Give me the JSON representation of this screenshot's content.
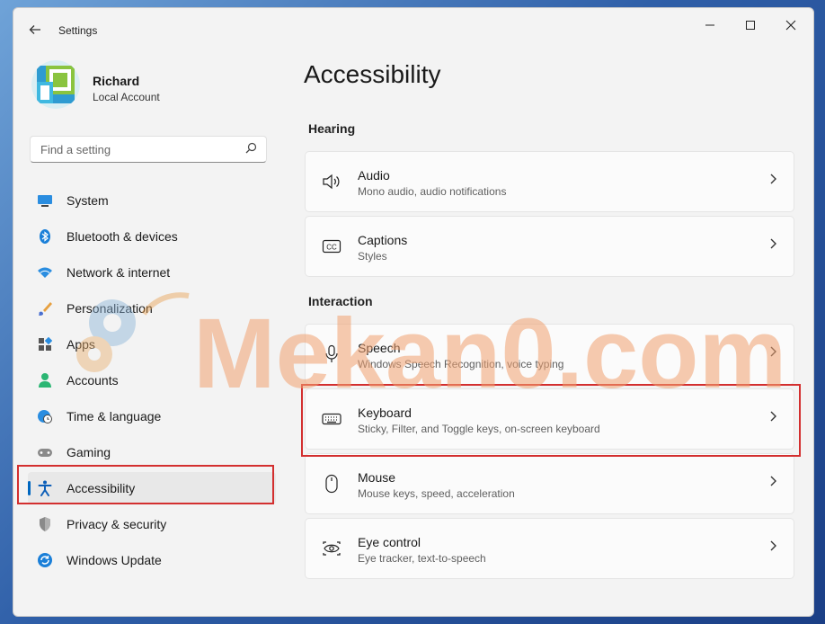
{
  "window": {
    "title": "Settings"
  },
  "user": {
    "name": "Richard",
    "account_type": "Local Account"
  },
  "search": {
    "placeholder": "Find a setting"
  },
  "sidebar": {
    "items": [
      {
        "label": "System",
        "icon": "monitor-icon"
      },
      {
        "label": "Bluetooth & devices",
        "icon": "bluetooth-icon"
      },
      {
        "label": "Network & internet",
        "icon": "wifi-icon"
      },
      {
        "label": "Personalization",
        "icon": "brush-icon"
      },
      {
        "label": "Apps",
        "icon": "apps-icon"
      },
      {
        "label": "Accounts",
        "icon": "person-icon"
      },
      {
        "label": "Time & language",
        "icon": "globe-clock-icon"
      },
      {
        "label": "Gaming",
        "icon": "controller-icon"
      },
      {
        "label": "Accessibility",
        "icon": "accessibility-icon",
        "active": true
      },
      {
        "label": "Privacy & security",
        "icon": "shield-icon"
      },
      {
        "label": "Windows Update",
        "icon": "update-icon"
      }
    ]
  },
  "main": {
    "title": "Accessibility",
    "sections": [
      {
        "title": "Hearing",
        "items": [
          {
            "title": "Audio",
            "subtitle": "Mono audio, audio notifications",
            "icon": "speaker-icon"
          },
          {
            "title": "Captions",
            "subtitle": "Styles",
            "icon": "captions-icon"
          }
        ]
      },
      {
        "title": "Interaction",
        "items": [
          {
            "title": "Speech",
            "subtitle": "Windows Speech Recognition, voice typing",
            "icon": "microphone-icon"
          },
          {
            "title": "Keyboard",
            "subtitle": "Sticky, Filter, and Toggle keys, on-screen keyboard",
            "icon": "keyboard-icon",
            "highlighted": true
          },
          {
            "title": "Mouse",
            "subtitle": "Mouse keys, speed, acceleration",
            "icon": "mouse-icon"
          },
          {
            "title": "Eye control",
            "subtitle": "Eye tracker, text-to-speech",
            "icon": "eye-icon"
          }
        ]
      }
    ]
  },
  "watermark": {
    "text": "Mekan0.com"
  },
  "colors": {
    "accent": "#0067c0",
    "highlight": "#d32f2f",
    "watermark": "#f0a070"
  }
}
